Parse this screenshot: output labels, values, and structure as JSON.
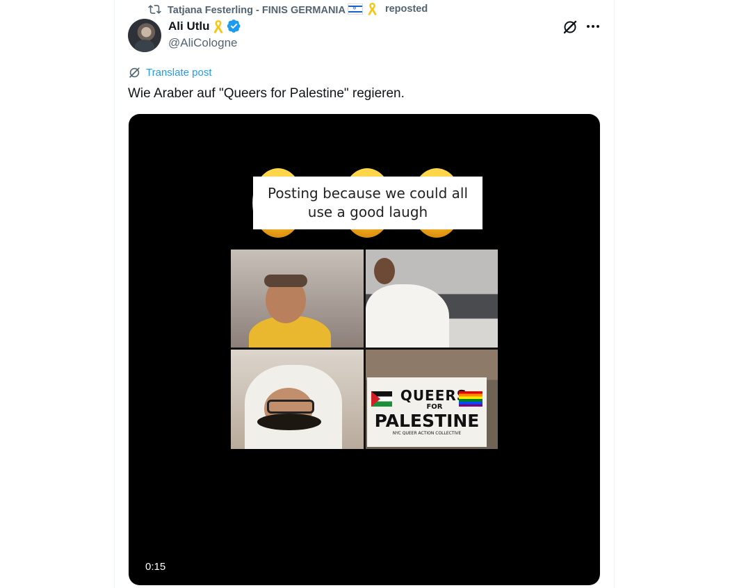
{
  "repost": {
    "icon": "repost-icon",
    "reposter": "Tatjana Festerling - FINIS GERMANIA",
    "flag": "israel-flag",
    "ribbon": "yellow-ribbon",
    "action": "reposted"
  },
  "author": {
    "display_name": "Ali Utlu",
    "ribbon": "yellow-ribbon",
    "verified": true,
    "handle": "@AliCologne"
  },
  "translate_label": "Translate post",
  "text": "Wie Araber auf \"Queers for Palestine\" regieren.",
  "video": {
    "caption_line1": "Posting because we could all",
    "caption_line2": "use a good laugh",
    "banner_line1": "QUEERS",
    "banner_line2": "FOR",
    "banner_line3": "PALESTINE",
    "banner_line4": "NYC QUEER ACTION COLLECTIVE",
    "duration": "0:15"
  },
  "colors": {
    "accent": "#1d9bf0",
    "secondary_text": "#536471",
    "ribbon": "#f5c518"
  }
}
